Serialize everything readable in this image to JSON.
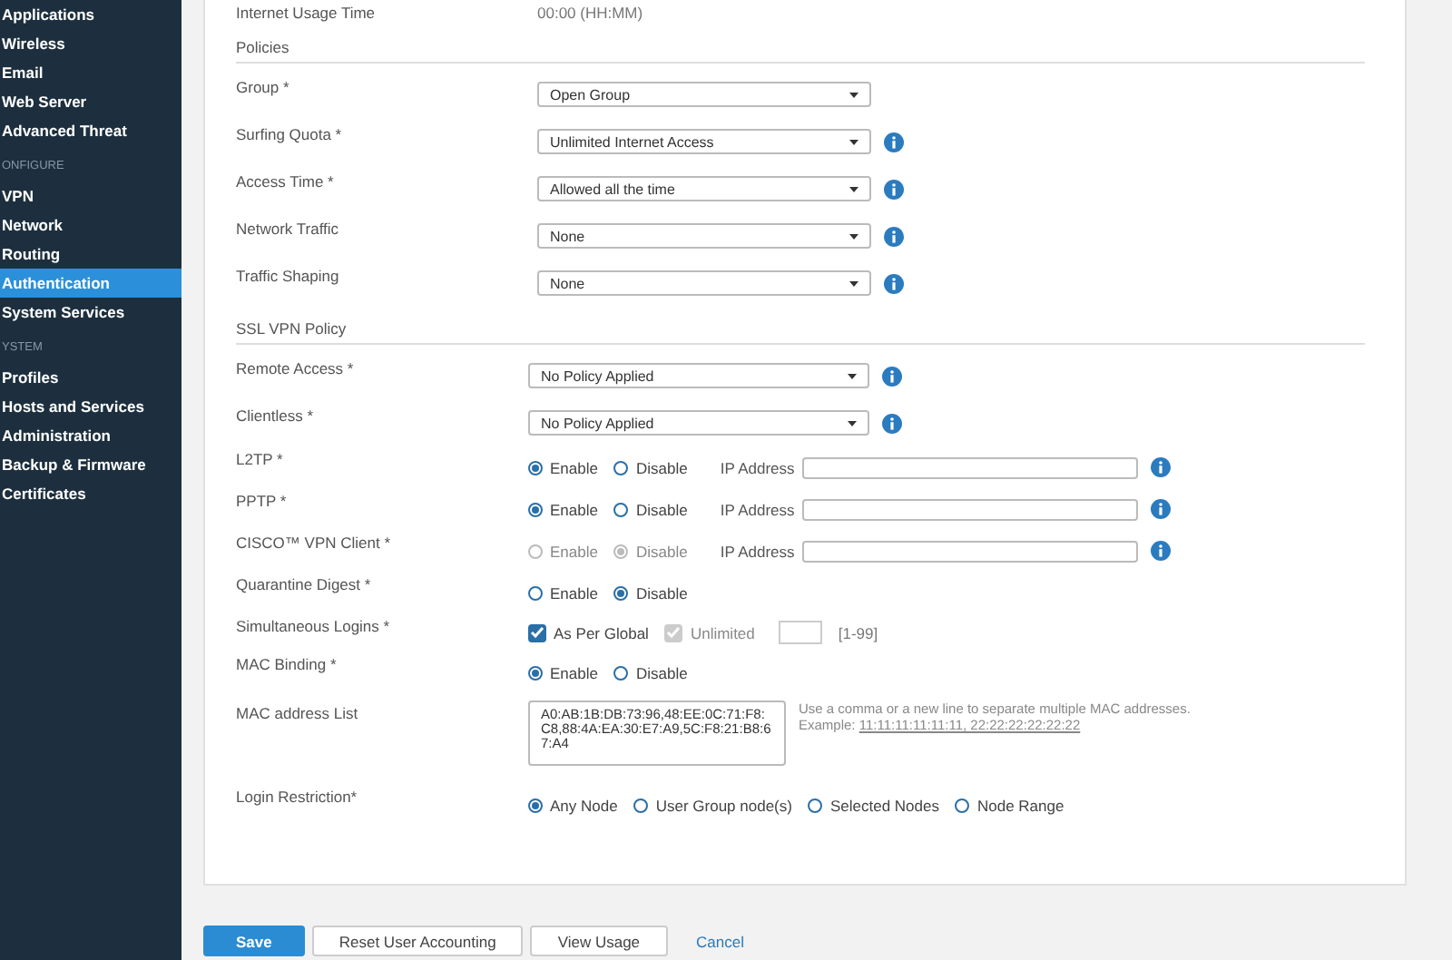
{
  "sidebar": {
    "items": [
      {
        "kind": "item",
        "label": "Applications",
        "selected": false
      },
      {
        "kind": "item",
        "label": "Wireless",
        "selected": false
      },
      {
        "kind": "item",
        "label": "Email",
        "selected": false
      },
      {
        "kind": "item",
        "label": "Web Server",
        "selected": false
      },
      {
        "kind": "item",
        "label": "Advanced Threat",
        "selected": false
      },
      {
        "kind": "heading",
        "label": "ONFIGURE"
      },
      {
        "kind": "item",
        "label": "VPN",
        "selected": false
      },
      {
        "kind": "item",
        "label": "Network",
        "selected": false
      },
      {
        "kind": "item",
        "label": "Routing",
        "selected": false
      },
      {
        "kind": "item",
        "label": "Authentication",
        "selected": true
      },
      {
        "kind": "item",
        "label": "System Services",
        "selected": false
      },
      {
        "kind": "heading",
        "label": "YSTEM"
      },
      {
        "kind": "item",
        "label": "Profiles",
        "selected": false
      },
      {
        "kind": "item",
        "label": "Hosts and Services",
        "selected": false
      },
      {
        "kind": "item",
        "label": "Administration",
        "selected": false
      },
      {
        "kind": "item",
        "label": "Backup & Firmware",
        "selected": false
      },
      {
        "kind": "item",
        "label": "Certificates",
        "selected": false
      }
    ]
  },
  "usage_row": {
    "label": "Internet Usage Time",
    "value": "00:00 (HH:MM)"
  },
  "sections": [
    {
      "title": "Policies",
      "rows": [
        {
          "kind": "select",
          "label": "Group *",
          "value": "Open Group",
          "info": false
        },
        {
          "kind": "select",
          "label": "Surfing Quota *",
          "value": "Unlimited Internet Access",
          "info": true
        },
        {
          "kind": "select",
          "label": "Access Time *",
          "value": "Allowed all the time",
          "info": true
        },
        {
          "kind": "select",
          "label": "Network Traffic",
          "value": "None",
          "info": true
        },
        {
          "kind": "select",
          "label": "Traffic Shaping",
          "value": "None",
          "info": true
        }
      ]
    },
    {
      "title": "SSL VPN Policy",
      "rows": [
        {
          "kind": "select",
          "label": "Remote Access *",
          "value": "No Policy Applied",
          "info": true
        },
        {
          "kind": "select",
          "label": "Clientless *",
          "value": "No Policy Applied",
          "info": true
        },
        {
          "kind": "radios",
          "label": "L2TP *",
          "options": [
            {
              "label": "Enable",
              "selected": true,
              "disabled": false
            },
            {
              "label": "Disable",
              "selected": false,
              "disabled": false
            }
          ],
          "ip_label": "IP Address",
          "info": true
        },
        {
          "kind": "radios",
          "label": "PPTP *",
          "options": [
            {
              "label": "Enable",
              "selected": true,
              "disabled": false
            },
            {
              "label": "Disable",
              "selected": false,
              "disabled": false
            }
          ],
          "ip_label": "IP Address",
          "info": true
        },
        {
          "kind": "radios",
          "label": "CISCO™ VPN Client *",
          "options": [
            {
              "label": "Enable",
              "selected": false,
              "disabled": true
            },
            {
              "label": "Disable",
              "selected": true,
              "disabled": true
            }
          ],
          "ip_label": "IP Address",
          "info": true
        },
        {
          "kind": "radios",
          "label": "Quarantine Digest *",
          "options": [
            {
              "label": "Enable",
              "selected": false,
              "disabled": false
            },
            {
              "label": "Disable",
              "selected": true,
              "disabled": false
            }
          ]
        },
        {
          "kind": "checks",
          "label": "Simultaneous Logins *",
          "options": [
            {
              "label": "As Per Global",
              "checked": true,
              "disabled": false
            },
            {
              "label": "Unlimited",
              "checked": true,
              "disabled": true
            }
          ],
          "range": "[1-99]"
        },
        {
          "kind": "radios",
          "label": "MAC Binding *",
          "options": [
            {
              "label": "Enable",
              "selected": true,
              "disabled": false
            },
            {
              "label": "Disable",
              "selected": false,
              "disabled": false
            }
          ]
        },
        {
          "kind": "textarea",
          "label": "MAC address List",
          "value": "A0:AB:1B:DB:73:96,48:EE:0C:71:F8:C8,88:4A:EA:30:E7:A9,5C:F8:21:B8:67:A4",
          "hint": "Use a comma or a new line to separate multiple MAC addresses.",
          "example_label": "Example:",
          "example": "11:11:11:11:11:11, 22:22:22:22:22:22"
        },
        {
          "kind": "radios",
          "label": "Login Restriction*",
          "options": [
            {
              "label": "Any Node",
              "selected": true,
              "disabled": false
            },
            {
              "label": "User Group node(s)",
              "selected": false,
              "disabled": false
            },
            {
              "label": "Selected Nodes",
              "selected": false,
              "disabled": false
            },
            {
              "label": "Node Range",
              "selected": false,
              "disabled": false
            }
          ]
        }
      ]
    }
  ],
  "buttons": [
    {
      "kind": "primary",
      "label": "Save"
    },
    {
      "kind": "default",
      "label": "Reset User Accounting"
    },
    {
      "kind": "default",
      "label": "View Usage"
    },
    {
      "kind": "link",
      "label": "Cancel"
    }
  ]
}
